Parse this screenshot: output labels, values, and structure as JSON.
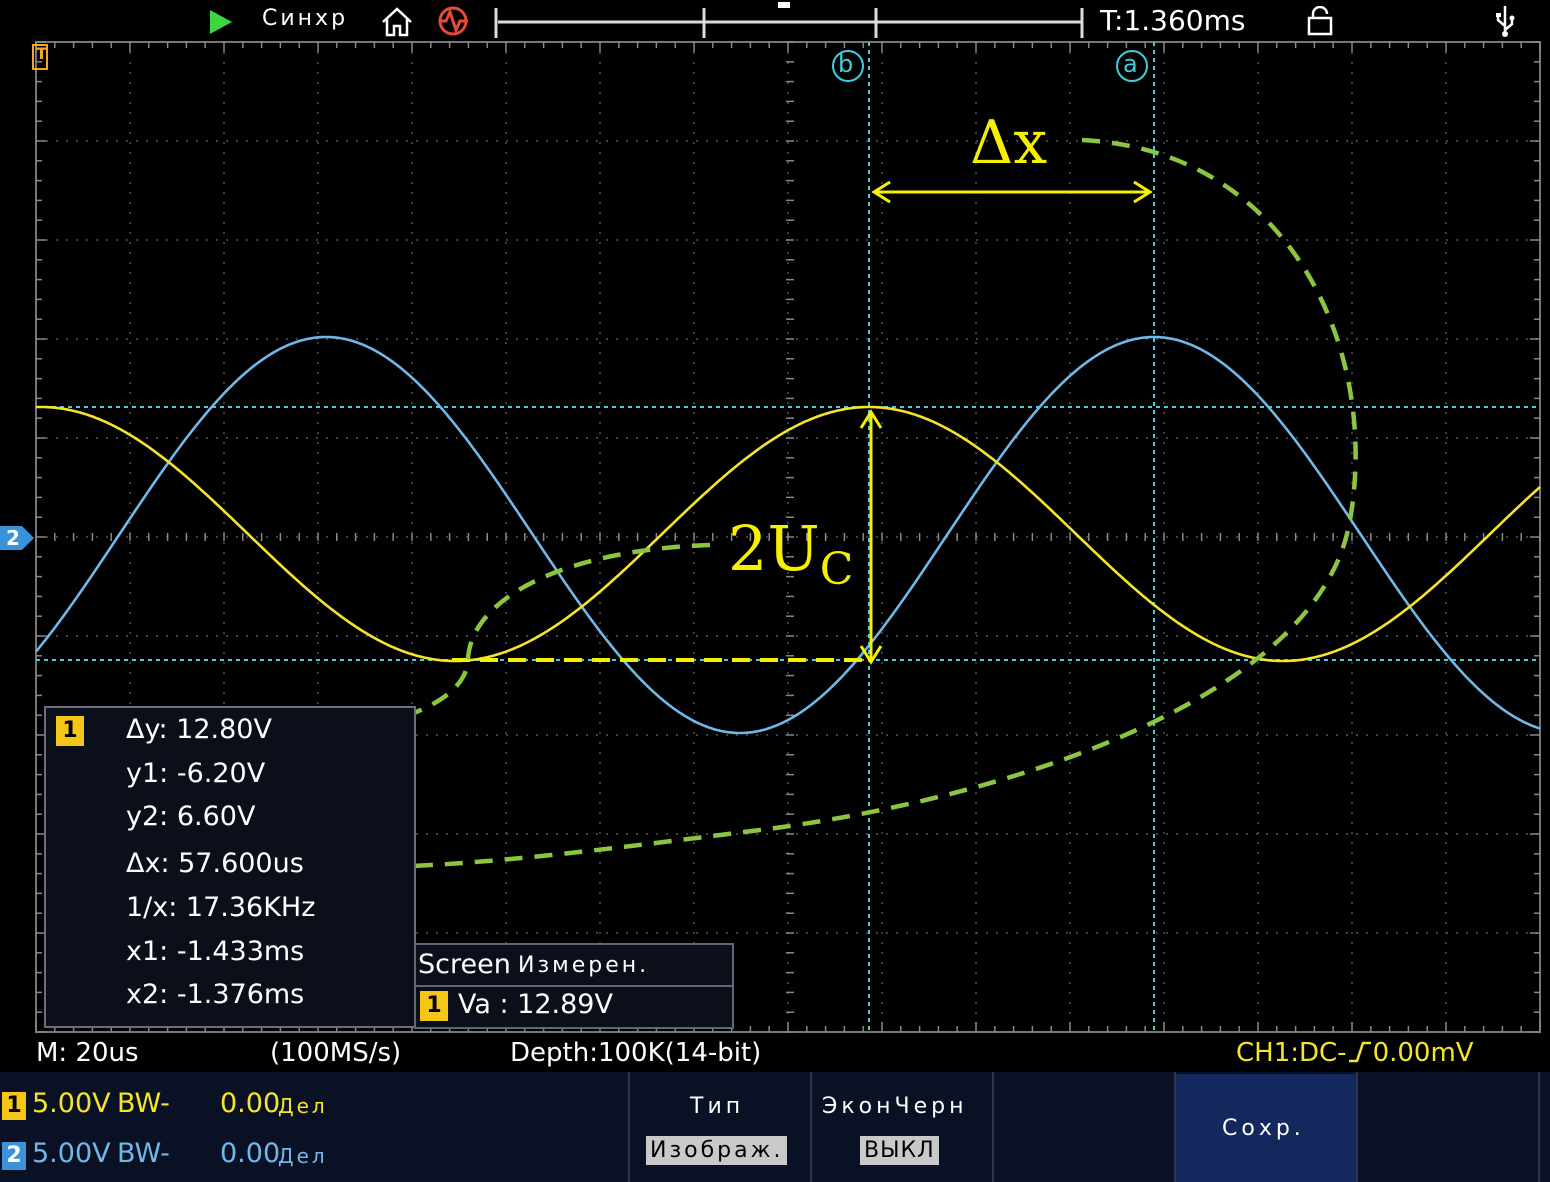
{
  "topbar": {
    "run_state": "Синхр",
    "timebase_position": "T:1.360ms"
  },
  "cursors": {
    "b_label": "b",
    "a_label": "a"
  },
  "channels": {
    "ch1_marker": "T",
    "ch2_marker": "2"
  },
  "annotations": {
    "delta_x": "Δx",
    "two_uc_main": "2U",
    "two_uc_sub": "C"
  },
  "cursor_readout": {
    "channel": "1",
    "dy": "Δy: 12.80V",
    "y1": "y1: -6.20V",
    "y2": "y2: 6.60V",
    "dx": "Δx: 57.600us",
    "inv_x": "1/x: 17.36KHz",
    "x1": "x1: -1.433ms",
    "x2": "x2: -1.376ms"
  },
  "measure_box": {
    "header_left": "Screen",
    "header_right": "Измерен.",
    "channel": "1",
    "value": "Va : 12.89V"
  },
  "status": {
    "timebase": "M: 20us",
    "sample_rate": "(100MS/s)",
    "depth": "Depth:100K(14-bit)",
    "trigger": "CH1:DC-",
    "trigger_level": "0.00mV"
  },
  "channel_settings": [
    {
      "num": "1",
      "scale": "5.00V",
      "bw": "BW-",
      "offset": "0.00",
      "unit": "Дел"
    },
    {
      "num": "2",
      "scale": "5.00V",
      "bw": "BW-",
      "offset": "0.00",
      "unit": "Дел"
    }
  ],
  "menu": {
    "type_label": "Тип",
    "type_value": "Изображ.",
    "eco_label": "ЭконЧерн",
    "eco_value": "ВЫКЛ",
    "save_label": "Сохр."
  },
  "colors": {
    "ch1": "#f5e52a",
    "ch2": "#6fb8e8",
    "cursor": "#3fd0e0",
    "grid": "#555555",
    "annotation_green": "#8cc63f"
  }
}
